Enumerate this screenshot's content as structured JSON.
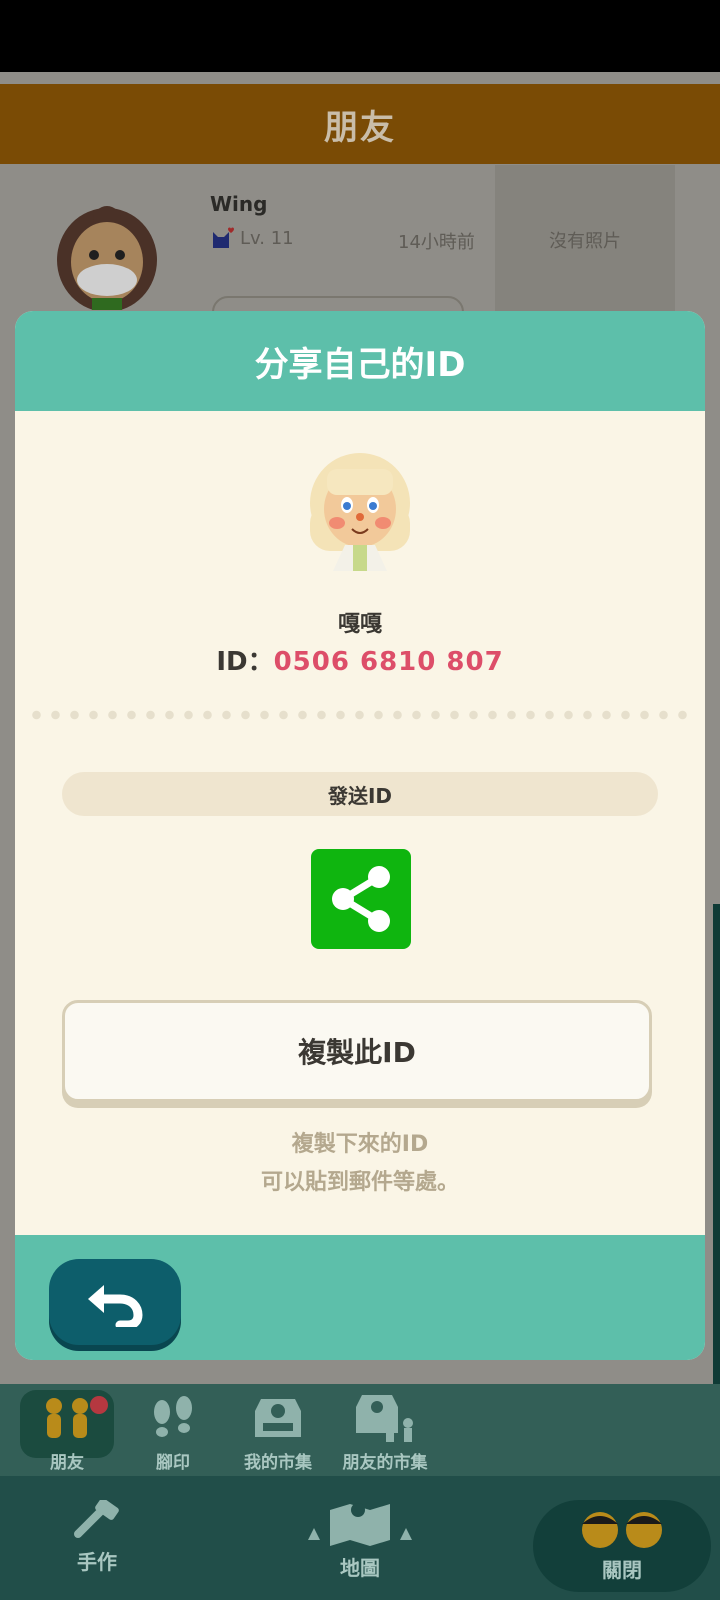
{
  "header": {
    "title": "朋友"
  },
  "friend": {
    "name": "Wing",
    "level": "Lv. 11",
    "last_seen": "14小時前",
    "photo_placeholder": "沒有照片"
  },
  "modal": {
    "title": "分享自己的ID",
    "player_name": "嘎嘎",
    "id_label": "ID：",
    "id_value": "0506 6810 807",
    "send_label": "發送ID",
    "copy_label": "複製此ID",
    "note_line1": "複製下來的ID",
    "note_line2": "可以貼到郵件等處。"
  },
  "tabs": [
    {
      "label": "朋友",
      "icon": "friends-icon"
    },
    {
      "label": "腳印",
      "icon": "footprints-icon"
    },
    {
      "label": "我的市集",
      "icon": "my-market-icon"
    },
    {
      "label": "朋友的市集",
      "icon": "friends-market-icon"
    }
  ],
  "bottom": {
    "craft": "手作",
    "map": "地圖",
    "close": "關閉"
  },
  "colors": {
    "accent_teal": "#5dbfaa",
    "id_pink": "#dd4e69",
    "share_green": "#0fb50f",
    "back_dark": "#0d5e6b"
  }
}
